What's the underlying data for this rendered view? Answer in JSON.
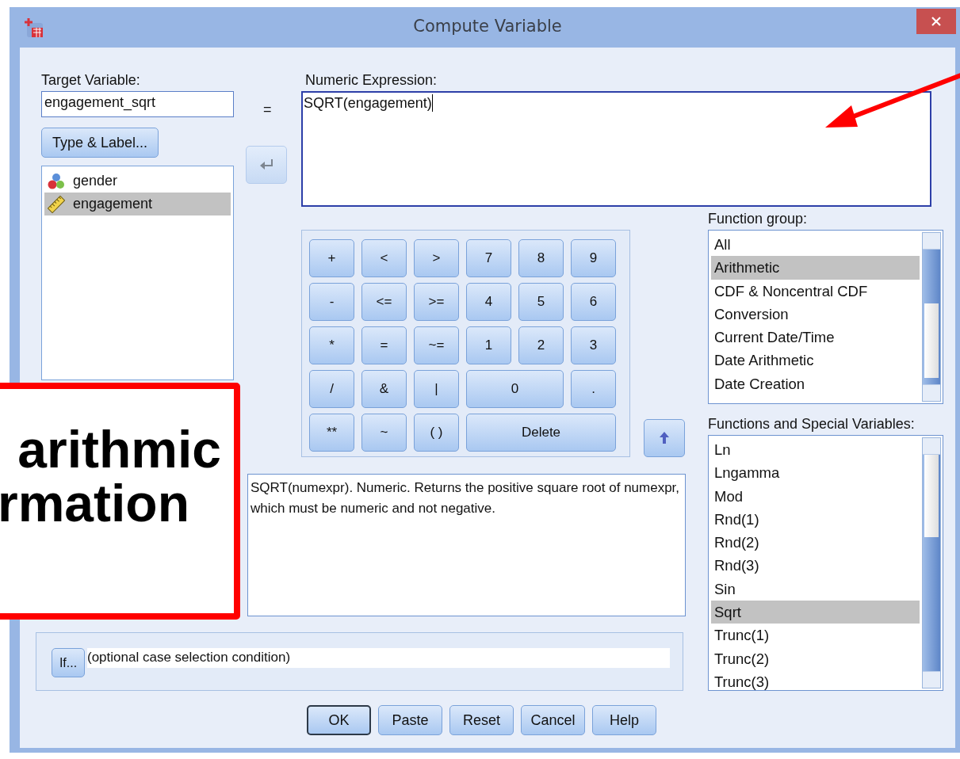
{
  "window": {
    "title": "Compute Variable"
  },
  "target_variable": {
    "label": "Target Variable:",
    "value": "engagement_sqrt"
  },
  "equals": "=",
  "type_label_button": "Type & Label...",
  "variables": [
    {
      "name": "gender",
      "kind": "nominal",
      "selected": false
    },
    {
      "name": "engagement",
      "kind": "scale",
      "selected": true
    }
  ],
  "numeric_expression": {
    "label": "Numeric Expression:",
    "value": "SQRT(engagement)"
  },
  "keypad": [
    {
      "label": "+",
      "kind": "key"
    },
    {
      "label": "<",
      "kind": "key"
    },
    {
      "label": ">",
      "kind": "key"
    },
    {
      "label": "7",
      "kind": "key"
    },
    {
      "label": "8",
      "kind": "key"
    },
    {
      "label": "9",
      "kind": "key"
    },
    {
      "label": "-",
      "kind": "key"
    },
    {
      "label": "<=",
      "kind": "key"
    },
    {
      "label": ">=",
      "kind": "key"
    },
    {
      "label": "4",
      "kind": "key"
    },
    {
      "label": "5",
      "kind": "key"
    },
    {
      "label": "6",
      "kind": "key"
    },
    {
      "label": "*",
      "kind": "key"
    },
    {
      "label": "=",
      "kind": "key"
    },
    {
      "label": "~=",
      "kind": "key"
    },
    {
      "label": "1",
      "kind": "key"
    },
    {
      "label": "2",
      "kind": "key"
    },
    {
      "label": "3",
      "kind": "key"
    },
    {
      "label": "/",
      "kind": "key"
    },
    {
      "label": "&",
      "kind": "key"
    },
    {
      "label": "|",
      "kind": "key"
    },
    {
      "label": "0",
      "kind": "doublekey"
    },
    {
      "label": ".",
      "kind": "key"
    },
    {
      "label": "**",
      "kind": "key"
    },
    {
      "label": "~",
      "kind": "key"
    },
    {
      "label": "( )",
      "kind": "key"
    },
    {
      "label": "Delete",
      "kind": "triplekey"
    }
  ],
  "description": "SQRT(numexpr). Numeric. Returns the positive square root of numexpr, which must be numeric and not negative.",
  "function_group": {
    "label": "Function group:",
    "items": [
      {
        "name": "All",
        "selected": false
      },
      {
        "name": "Arithmetic",
        "selected": true
      },
      {
        "name": "CDF & Noncentral CDF",
        "selected": false
      },
      {
        "name": "Conversion",
        "selected": false
      },
      {
        "name": "Current Date/Time",
        "selected": false
      },
      {
        "name": "Date Arithmetic",
        "selected": false
      },
      {
        "name": "Date Creation",
        "selected": false
      }
    ]
  },
  "functions": {
    "label": "Functions and Special Variables:",
    "items": [
      {
        "name": "Ln",
        "selected": false
      },
      {
        "name": "Lngamma",
        "selected": false
      },
      {
        "name": "Mod",
        "selected": false
      },
      {
        "name": "Rnd(1)",
        "selected": false
      },
      {
        "name": "Rnd(2)",
        "selected": false
      },
      {
        "name": "Rnd(3)",
        "selected": false
      },
      {
        "name": "Sin",
        "selected": false
      },
      {
        "name": "Sqrt",
        "selected": true
      },
      {
        "name": "Trunc(1)",
        "selected": false
      },
      {
        "name": "Trunc(2)",
        "selected": false
      },
      {
        "name": "Trunc(3)",
        "selected": false
      }
    ]
  },
  "if_button": "If...",
  "if_condition": "(optional case selection condition)",
  "buttons": [
    {
      "label": "OK",
      "default": true
    },
    {
      "label": "Paste",
      "default": false
    },
    {
      "label": "Reset",
      "default": false
    },
    {
      "label": "Cancel",
      "default": false
    },
    {
      "label": "Help",
      "default": false
    }
  ],
  "callout": {
    "lines": [
      "arithmic",
      "rmation"
    ]
  }
}
